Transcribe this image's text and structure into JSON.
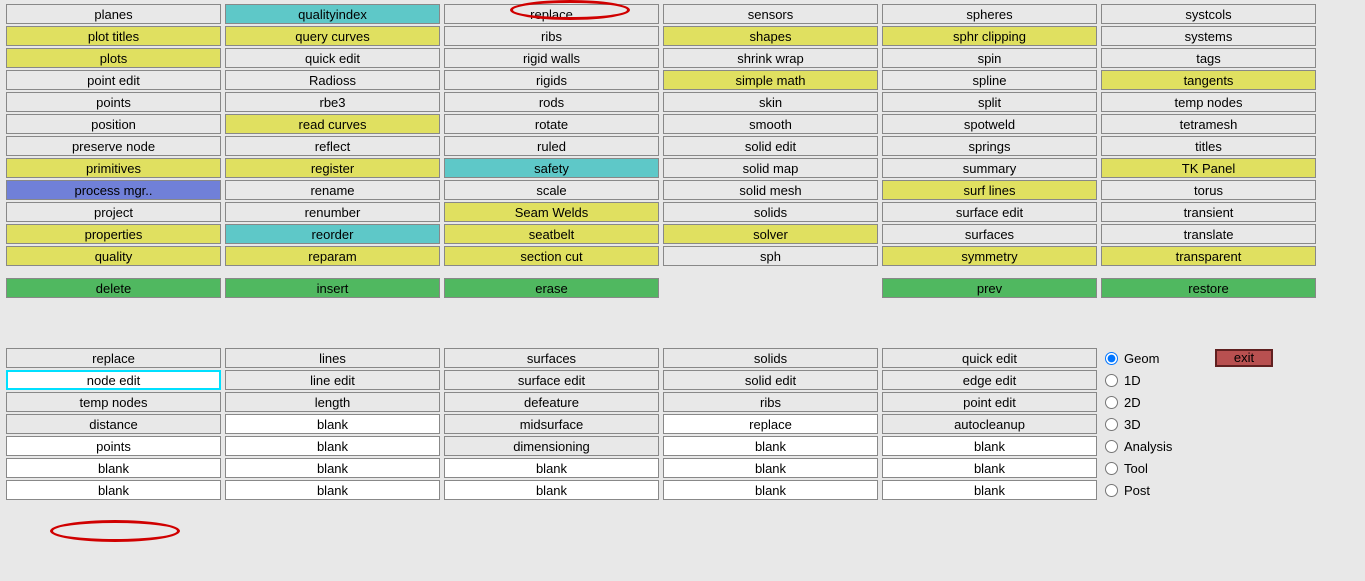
{
  "top_grid": [
    [
      {
        "t": "planes",
        "c": ""
      },
      {
        "t": "qualityindex",
        "c": "cyan"
      },
      {
        "t": "replace",
        "c": ""
      },
      {
        "t": "sensors",
        "c": ""
      },
      {
        "t": "spheres",
        "c": ""
      },
      {
        "t": "systcols",
        "c": ""
      }
    ],
    [
      {
        "t": "plot titles",
        "c": "yellow"
      },
      {
        "t": "query curves",
        "c": "yellow"
      },
      {
        "t": "ribs",
        "c": ""
      },
      {
        "t": "shapes",
        "c": "yellow"
      },
      {
        "t": "sphr clipping",
        "c": "yellow"
      },
      {
        "t": "systems",
        "c": ""
      }
    ],
    [
      {
        "t": "plots",
        "c": "yellow"
      },
      {
        "t": "quick edit",
        "c": ""
      },
      {
        "t": "rigid walls",
        "c": ""
      },
      {
        "t": "shrink wrap",
        "c": ""
      },
      {
        "t": "spin",
        "c": ""
      },
      {
        "t": "tags",
        "c": ""
      }
    ],
    [
      {
        "t": "point edit",
        "c": ""
      },
      {
        "t": "Radioss",
        "c": ""
      },
      {
        "t": "rigids",
        "c": ""
      },
      {
        "t": "simple math",
        "c": "yellow"
      },
      {
        "t": "spline",
        "c": ""
      },
      {
        "t": "tangents",
        "c": "yellow"
      }
    ],
    [
      {
        "t": "points",
        "c": ""
      },
      {
        "t": "rbe3",
        "c": ""
      },
      {
        "t": "rods",
        "c": ""
      },
      {
        "t": "skin",
        "c": ""
      },
      {
        "t": "split",
        "c": ""
      },
      {
        "t": "temp nodes",
        "c": ""
      }
    ],
    [
      {
        "t": "position",
        "c": ""
      },
      {
        "t": "read curves",
        "c": "yellow"
      },
      {
        "t": "rotate",
        "c": ""
      },
      {
        "t": "smooth",
        "c": ""
      },
      {
        "t": "spotweld",
        "c": ""
      },
      {
        "t": "tetramesh",
        "c": ""
      }
    ],
    [
      {
        "t": "preserve node",
        "c": ""
      },
      {
        "t": "reflect",
        "c": ""
      },
      {
        "t": "ruled",
        "c": ""
      },
      {
        "t": "solid edit",
        "c": ""
      },
      {
        "t": "springs",
        "c": ""
      },
      {
        "t": "titles",
        "c": ""
      }
    ],
    [
      {
        "t": "primitives",
        "c": "yellow"
      },
      {
        "t": "register",
        "c": "yellow"
      },
      {
        "t": "safety",
        "c": "cyan"
      },
      {
        "t": "solid map",
        "c": ""
      },
      {
        "t": "summary",
        "c": ""
      },
      {
        "t": "TK Panel",
        "c": "yellow"
      }
    ],
    [
      {
        "t": "process mgr..",
        "c": "blue"
      },
      {
        "t": "rename",
        "c": ""
      },
      {
        "t": "scale",
        "c": ""
      },
      {
        "t": "solid mesh",
        "c": ""
      },
      {
        "t": "surf lines",
        "c": "yellow"
      },
      {
        "t": "torus",
        "c": ""
      }
    ],
    [
      {
        "t": "project",
        "c": ""
      },
      {
        "t": "renumber",
        "c": ""
      },
      {
        "t": "Seam Welds",
        "c": "yellow"
      },
      {
        "t": "solids",
        "c": ""
      },
      {
        "t": "surface edit",
        "c": ""
      },
      {
        "t": "transient",
        "c": ""
      }
    ],
    [
      {
        "t": "properties",
        "c": "yellow"
      },
      {
        "t": "reorder",
        "c": "cyan"
      },
      {
        "t": "seatbelt",
        "c": "yellow"
      },
      {
        "t": "solver",
        "c": "yellow"
      },
      {
        "t": "surfaces",
        "c": ""
      },
      {
        "t": "translate",
        "c": ""
      }
    ],
    [
      {
        "t": "quality",
        "c": "yellow"
      },
      {
        "t": "reparam",
        "c": "yellow"
      },
      {
        "t": "section cut",
        "c": "yellow"
      },
      {
        "t": "sph",
        "c": ""
      },
      {
        "t": "symmetry",
        "c": "yellow"
      },
      {
        "t": "transparent",
        "c": "yellow"
      }
    ]
  ],
  "action_row": [
    {
      "t": "delete",
      "c": "green"
    },
    {
      "t": "insert",
      "c": "green"
    },
    {
      "t": "erase",
      "c": "green"
    },
    {
      "t": "",
      "c": "empty"
    },
    {
      "t": "prev",
      "c": "green"
    },
    {
      "t": "restore",
      "c": "green"
    }
  ],
  "bottom_grid": [
    [
      {
        "t": "replace",
        "c": ""
      },
      {
        "t": "lines",
        "c": ""
      },
      {
        "t": "surfaces",
        "c": ""
      },
      {
        "t": "solids",
        "c": ""
      },
      {
        "t": "quick edit",
        "c": ""
      }
    ],
    [
      {
        "t": "node edit",
        "c": "white highlight-border"
      },
      {
        "t": "line edit",
        "c": ""
      },
      {
        "t": "surface edit",
        "c": ""
      },
      {
        "t": "solid edit",
        "c": ""
      },
      {
        "t": "edge edit",
        "c": ""
      }
    ],
    [
      {
        "t": "temp nodes",
        "c": ""
      },
      {
        "t": "length",
        "c": ""
      },
      {
        "t": "defeature",
        "c": ""
      },
      {
        "t": "ribs",
        "c": ""
      },
      {
        "t": "point edit",
        "c": ""
      }
    ],
    [
      {
        "t": "distance",
        "c": ""
      },
      {
        "t": "blank",
        "c": "white"
      },
      {
        "t": "midsurface",
        "c": ""
      },
      {
        "t": "replace",
        "c": "white"
      },
      {
        "t": "autocleanup",
        "c": ""
      }
    ],
    [
      {
        "t": "points",
        "c": "white"
      },
      {
        "t": "blank",
        "c": "white"
      },
      {
        "t": "dimensioning",
        "c": ""
      },
      {
        "t": "blank",
        "c": "white"
      },
      {
        "t": "blank",
        "c": "white"
      }
    ],
    [
      {
        "t": "blank",
        "c": "white"
      },
      {
        "t": "blank",
        "c": "white"
      },
      {
        "t": "blank",
        "c": "white"
      },
      {
        "t": "blank",
        "c": "white"
      },
      {
        "t": "blank",
        "c": "white"
      }
    ],
    [
      {
        "t": "blank",
        "c": "white"
      },
      {
        "t": "blank",
        "c": "white"
      },
      {
        "t": "blank",
        "c": "white"
      },
      {
        "t": "blank",
        "c": "white"
      },
      {
        "t": "blank",
        "c": "white"
      }
    ]
  ],
  "radios": [
    {
      "label": "Geom",
      "checked": true
    },
    {
      "label": "1D",
      "checked": false
    },
    {
      "label": "2D",
      "checked": false
    },
    {
      "label": "3D",
      "checked": false
    },
    {
      "label": "Analysis",
      "checked": false
    },
    {
      "label": "Tool",
      "checked": false
    },
    {
      "label": "Post",
      "checked": false
    }
  ],
  "exit_label": "exit"
}
